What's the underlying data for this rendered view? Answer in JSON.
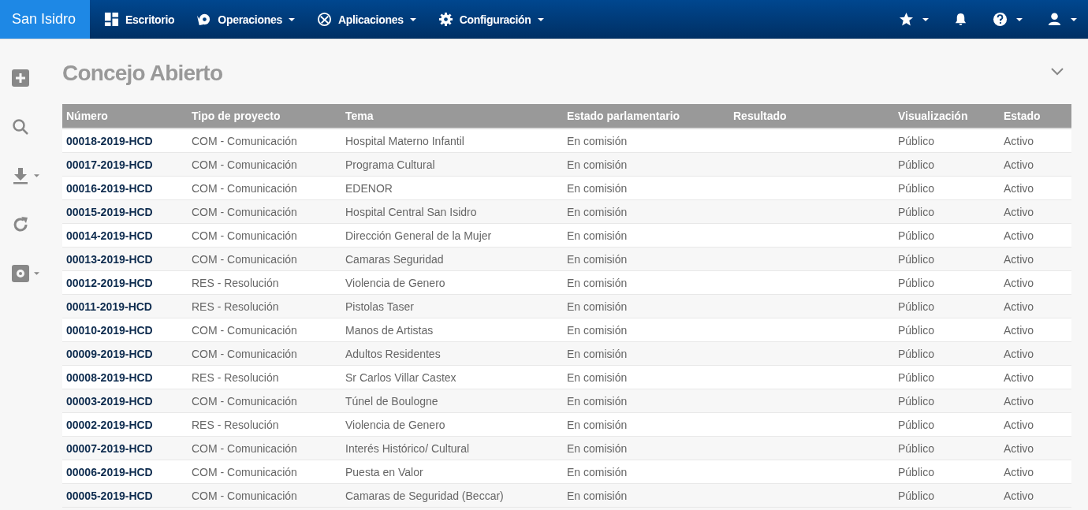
{
  "navbar": {
    "brand": "San Isidro",
    "menus": [
      {
        "label": "Escritorio",
        "kind": "grid",
        "dropdown": false
      },
      {
        "label": "Operaciones",
        "kind": "ops",
        "dropdown": true
      },
      {
        "label": "Aplicaciones",
        "kind": "apps",
        "dropdown": true
      },
      {
        "label": "Configuración",
        "kind": "gear",
        "dropdown": true
      }
    ],
    "right": [
      {
        "kind": "star",
        "dropdown": true
      },
      {
        "kind": "bell",
        "dropdown": false
      },
      {
        "kind": "help",
        "dropdown": true
      },
      {
        "kind": "user",
        "dropdown": true
      }
    ]
  },
  "sidebar": [
    {
      "kind": "add",
      "dropdown": false
    },
    {
      "kind": "search",
      "dropdown": false
    },
    {
      "kind": "download",
      "dropdown": true
    },
    {
      "kind": "refresh",
      "dropdown": false
    },
    {
      "kind": "settings",
      "dropdown": true
    }
  ],
  "page": {
    "title": "Concejo Abierto"
  },
  "table": {
    "columns": [
      "Número",
      "Tipo de proyecto",
      "Tema",
      "Estado parlamentario",
      "Resultado",
      "Visualización",
      "Estado"
    ],
    "rows": [
      [
        "00018-2019-HCD",
        "COM - Comunicación",
        "Hospital Materno Infantil",
        "En comisión",
        "",
        "Público",
        "Activo"
      ],
      [
        "00017-2019-HCD",
        "COM - Comunicación",
        "Programa Cultural",
        "En comisión",
        "",
        "Público",
        "Activo"
      ],
      [
        "00016-2019-HCD",
        "COM - Comunicación",
        "EDENOR",
        "En comisión",
        "",
        "Público",
        "Activo"
      ],
      [
        "00015-2019-HCD",
        "COM - Comunicación",
        "Hospital Central San Isidro",
        "En comisión",
        "",
        "Público",
        "Activo"
      ],
      [
        "00014-2019-HCD",
        "COM - Comunicación",
        "Dirección General de la Mujer",
        "En comisión",
        "",
        "Público",
        "Activo"
      ],
      [
        "00013-2019-HCD",
        "COM - Comunicación",
        "Camaras Seguridad",
        "En comisión",
        "",
        "Público",
        "Activo"
      ],
      [
        "00012-2019-HCD",
        "RES - Resolución",
        "Violencia de Genero",
        "En comisión",
        "",
        "Público",
        "Activo"
      ],
      [
        "00011-2019-HCD",
        "RES - Resolución",
        "Pistolas Taser",
        "En comisión",
        "",
        "Público",
        "Activo"
      ],
      [
        "00010-2019-HCD",
        "COM - Comunicación",
        "Manos de Artistas",
        "En comisión",
        "",
        "Público",
        "Activo"
      ],
      [
        "00009-2019-HCD",
        "COM - Comunicación",
        "Adultos Residentes",
        "En comisión",
        "",
        "Público",
        "Activo"
      ],
      [
        "00008-2019-HCD",
        "RES - Resolución",
        "Sr Carlos Villar Castex",
        "En comisión",
        "",
        "Público",
        "Activo"
      ],
      [
        "00003-2019-HCD",
        "COM - Comunicación",
        "Túnel de Boulogne",
        "En comisión",
        "",
        "Público",
        "Activo"
      ],
      [
        "00002-2019-HCD",
        "RES - Resolución",
        "Violencia de Genero",
        "En comisión",
        "",
        "Público",
        "Activo"
      ],
      [
        "00007-2019-HCD",
        "COM - Comunicación",
        "Interés Histórico/ Cultural",
        "En comisión",
        "",
        "Público",
        "Activo"
      ],
      [
        "00006-2019-HCD",
        "COM - Comunicación",
        "Puesta en Valor",
        "En comisión",
        "",
        "Público",
        "Activo"
      ],
      [
        "00005-2019-HCD",
        "COM - Comunicación",
        "Camaras de Seguridad (Beccar)",
        "En comisión",
        "",
        "Público",
        "Activo"
      ]
    ]
  }
}
